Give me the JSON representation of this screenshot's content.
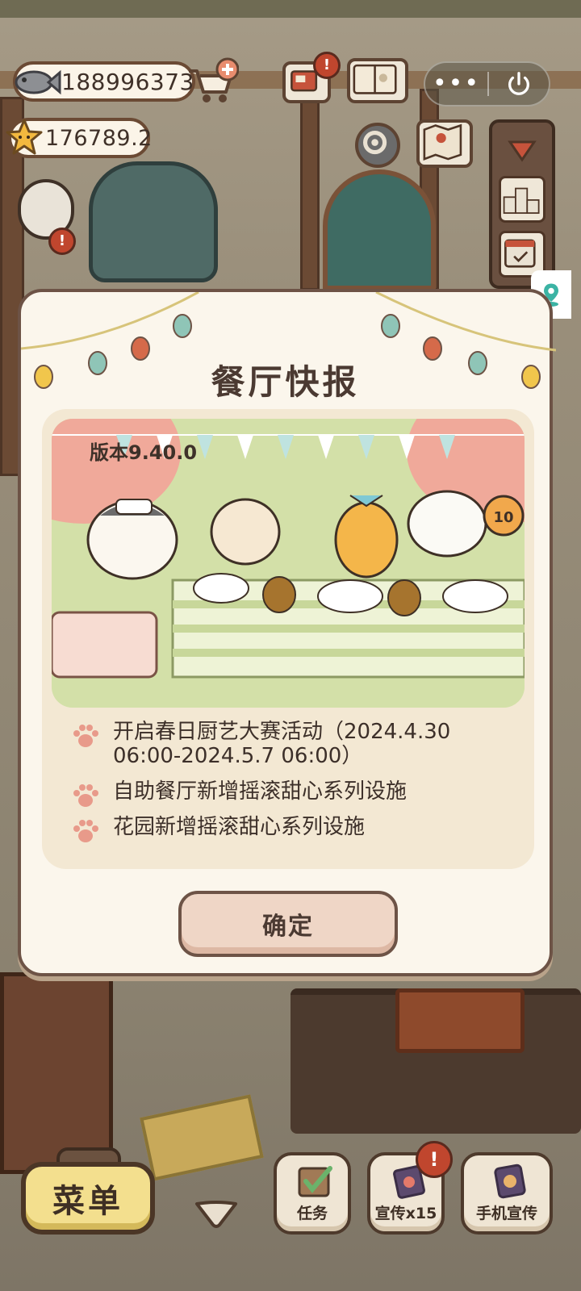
{
  "hud": {
    "fish_amount": "188996373",
    "star_amount": "176789.2",
    "icons": [
      "fish-icon",
      "star-icon",
      "shopping-cart-plus-icon",
      "mailbox-icon",
      "recipe-book-icon",
      "settings-gear-icon",
      "map-icon",
      "more-icon",
      "power-icon",
      "collapse-triangle-icon",
      "ranking-podium-icon",
      "calendar-check-icon",
      "location-pin-icon"
    ],
    "alert_mark": "!"
  },
  "system": {
    "more_label": "•••"
  },
  "dialog": {
    "title": "餐厅快报",
    "version": "版本9.40.0",
    "items": [
      {
        "text": "开启春日厨艺大赛活动（2024.4.30 06:00-2024.5.7 06:00）"
      },
      {
        "text": "自助餐厅新增摇滚甜心系列设施"
      },
      {
        "text": "花园新增摇滚甜心系列设施"
      }
    ],
    "confirm_label": "确定",
    "sign_number": "10"
  },
  "bottom_bar": {
    "menu_label": "菜单",
    "task_label": "任务",
    "promo_label": "宣传x15",
    "phone_promo_label": "手机宣传",
    "alert_mark": "!"
  },
  "colors": {
    "dialog_bg": "#fbf6ec",
    "card_bg": "#f3e8d3",
    "border_brown": "#6d5346",
    "confirm_bg": "#efd6c6",
    "menu_yellow": "#f3df8e",
    "paw_pink": "#e89a8a",
    "alert_red": "#c0462e"
  }
}
